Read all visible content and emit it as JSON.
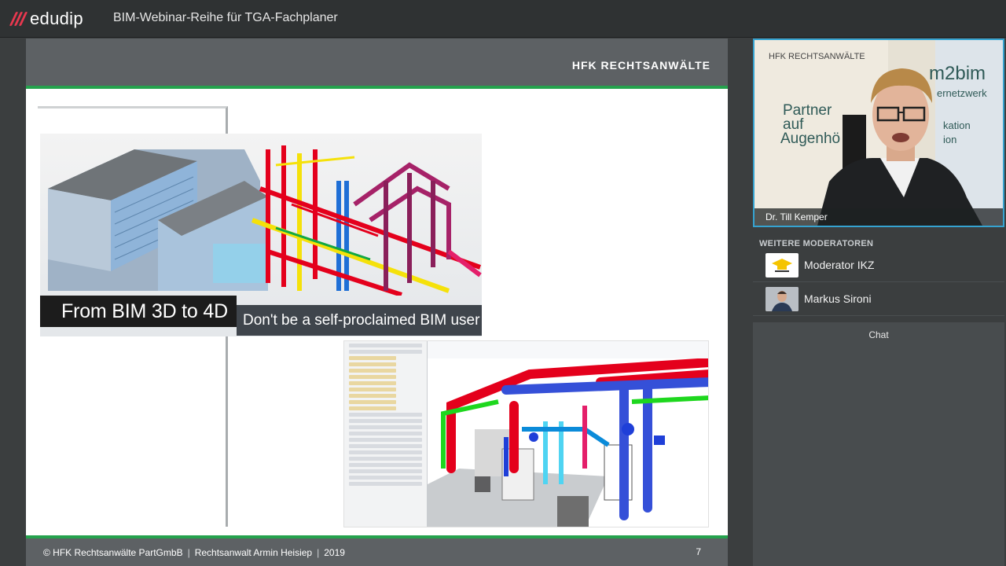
{
  "app": {
    "brand": "edudip",
    "title": "BIM-Webinar-Reihe für TGA-Fachplaner",
    "accent_color": "#e8384f"
  },
  "slide": {
    "brand": "HFK RECHTSANWÄLTE",
    "header_color": "#5d6164",
    "line_color": "#25a24d",
    "banner_left": "From BIM 3D to 4D",
    "banner_right": "Don't be a self-proclaimed BIM user",
    "footer": {
      "copyright": "© HFK Rechtsanwälte PartGmbB",
      "author": "Rechtsanwalt Armin Heisiep",
      "year": "2019",
      "page": "7"
    }
  },
  "presenter": {
    "name": "Dr. Till Kemper",
    "background_text": [
      "HFK RECHTSANWÄLTE",
      "Partner",
      "auf",
      "Augenhö",
      "m2bim",
      "ernetzwerk",
      "kation",
      "ion"
    ],
    "border_color": "#35a3d1"
  },
  "moderators": {
    "label": "WEITERE MODERATOREN",
    "items": [
      {
        "name": "Moderator IKZ",
        "avatar": "ikz-logo"
      },
      {
        "name": "Markus Sironi",
        "avatar": "person-photo"
      }
    ]
  },
  "chat": {
    "title": "Chat"
  }
}
